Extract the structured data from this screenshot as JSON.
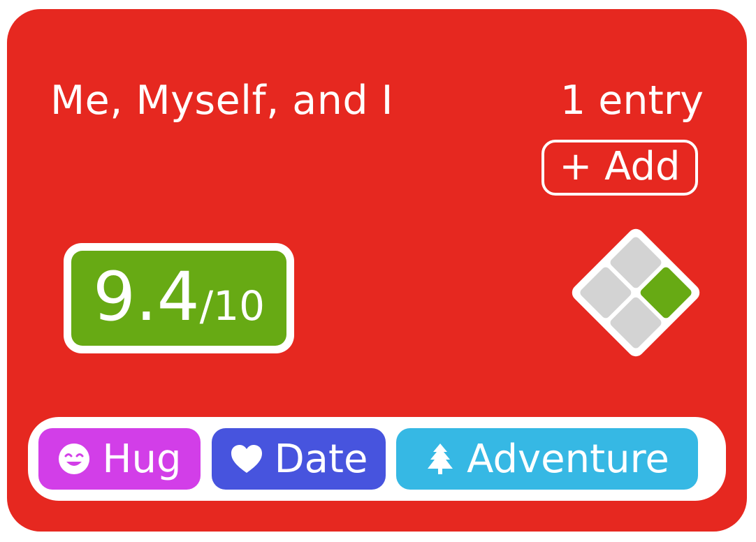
{
  "card": {
    "title": "Me, Myself, and I",
    "entry_count": "1 entry",
    "add_label": "+ Add",
    "background_color": "#e62820"
  },
  "score": {
    "value": "9.4",
    "max": "/10",
    "color": "#67aa14"
  },
  "grid": {
    "cells": [
      {
        "position": "top",
        "state": "empty",
        "color": "#d3d3d3"
      },
      {
        "position": "left",
        "state": "empty",
        "color": "#d3d3d3"
      },
      {
        "position": "right",
        "state": "filled",
        "color": "#67aa14"
      },
      {
        "position": "bottom",
        "state": "empty",
        "color": "#d3d3d3"
      }
    ]
  },
  "tags": [
    {
      "label": "Hug",
      "icon": "smile-icon",
      "color": "#d23ee8"
    },
    {
      "label": "Date",
      "icon": "heart-icon",
      "color": "#4754de"
    },
    {
      "label": "Adventure",
      "icon": "tree-icon",
      "color": "#36b8e4"
    }
  ]
}
